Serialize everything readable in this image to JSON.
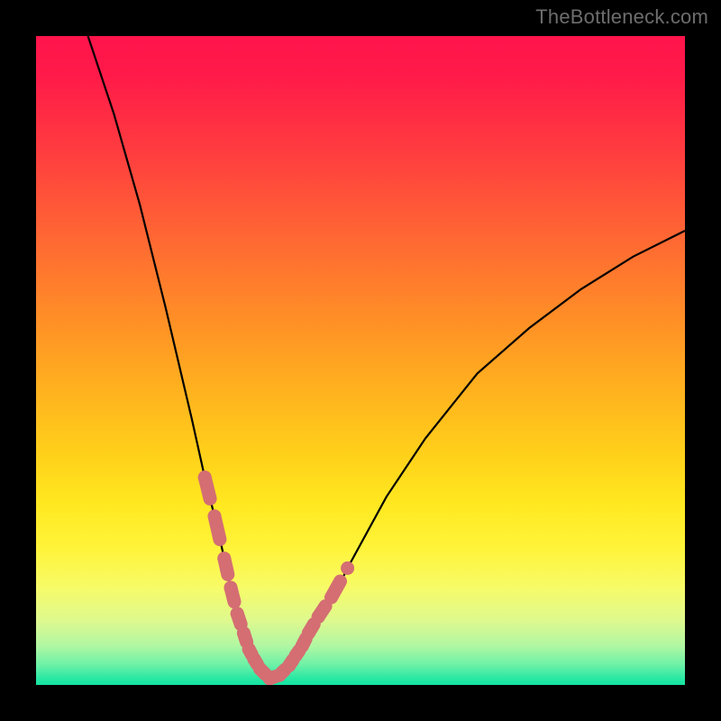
{
  "watermark": "TheBottleneck.com",
  "colors": {
    "frame": "#000000",
    "markers": "#d46e73",
    "curve": "#000000",
    "gradient_top": "#ff144b",
    "gradient_bottom": "#14e3a1"
  },
  "chart_data": {
    "type": "line",
    "title": "",
    "xlabel": "",
    "ylabel": "",
    "xlim": [
      0,
      100
    ],
    "ylim": [
      0,
      100
    ],
    "grid": false,
    "legend": false,
    "series": [
      {
        "name": "bottleneck-curve",
        "x": [
          8,
          12,
          16,
          20,
          24,
          26,
          28,
          30,
          32,
          33,
          34,
          35,
          36,
          37,
          38,
          40,
          44,
          48,
          54,
          60,
          68,
          76,
          84,
          92,
          100
        ],
        "y": [
          100,
          88,
          74,
          58,
          41,
          32,
          24,
          15,
          8,
          5,
          3,
          1,
          1,
          1,
          2,
          4,
          10,
          18,
          29,
          38,
          48,
          55,
          61,
          66,
          70
        ]
      }
    ],
    "markers": {
      "name": "highlighted-points",
      "style": "pill",
      "x": [
        26,
        27.5,
        29,
        30,
        31,
        32,
        32.8,
        33.6,
        34.5,
        36,
        37.5,
        39,
        40,
        41,
        42,
        43.5,
        45.5,
        48
      ],
      "y": [
        32,
        26,
        19.5,
        15,
        11,
        8,
        5.5,
        4,
        2.5,
        1,
        1.5,
        3,
        4.5,
        6,
        8,
        10.5,
        13.5,
        18
      ]
    }
  }
}
